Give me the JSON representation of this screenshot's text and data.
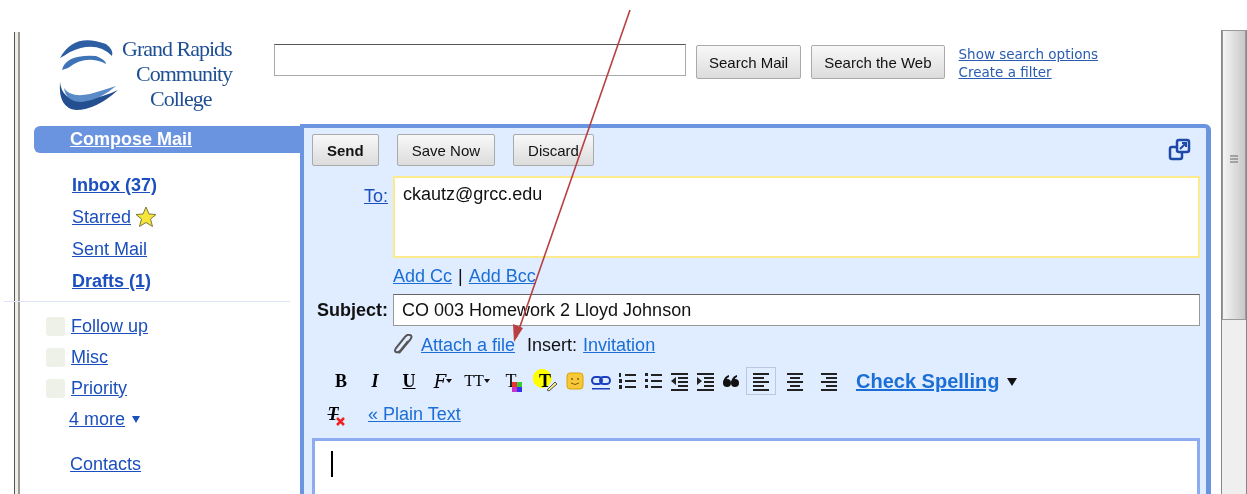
{
  "logo": {
    "lines": [
      "Grand Rapids",
      "Community",
      "College"
    ]
  },
  "search": {
    "buttons": [
      "Search Mail",
      "Search the Web"
    ],
    "links": [
      "Show search options",
      "Create a filter"
    ]
  },
  "sidebar": {
    "compose": "Compose Mail",
    "folders": [
      {
        "label": "Inbox (37)",
        "unread": true,
        "starred": false
      },
      {
        "label": "Starred",
        "unread": false,
        "starred": true
      },
      {
        "label": "Sent Mail",
        "unread": false,
        "starred": false
      },
      {
        "label": "Drafts (1)",
        "unread": true,
        "starred": false
      }
    ],
    "labels": [
      "Follow up",
      "Misc",
      "Priority"
    ],
    "more": "4 more",
    "contacts": "Contacts"
  },
  "compose": {
    "buttons": [
      {
        "label": "Send",
        "primary": true
      },
      {
        "label": "Save Now",
        "primary": false
      },
      {
        "label": "Discard",
        "primary": false
      }
    ],
    "to_label": "To:",
    "to_value": "ckautz@grcc.edu",
    "add_cc": "Add Cc",
    "separator": "|",
    "add_bcc": "Add Bcc",
    "subject_label": "Subject:",
    "subject_value": "CO 003 Homework 2 Lloyd Johnson",
    "attach": "Attach a file",
    "insert_label": "Insert:",
    "insert_link": "Invitation",
    "tools": [
      {
        "kind": "bold",
        "text": "B"
      },
      {
        "kind": "italic",
        "text": "I"
      },
      {
        "kind": "underline",
        "text": "U"
      },
      {
        "kind": "font",
        "text": "F"
      },
      {
        "kind": "size",
        "text": "TT"
      },
      {
        "kind": "text-color",
        "text": "T"
      },
      {
        "kind": "highlight",
        "text": "T"
      },
      {
        "kind": "emoji"
      },
      {
        "kind": "link"
      },
      {
        "kind": "numbered-list"
      },
      {
        "kind": "bullet-list"
      },
      {
        "kind": "outdent"
      },
      {
        "kind": "indent"
      },
      {
        "kind": "quote"
      },
      {
        "kind": "align-left",
        "selected": true
      },
      {
        "kind": "align-center",
        "selected": false
      },
      {
        "kind": "align-right",
        "selected": false
      }
    ],
    "check_spelling": "Check Spelling",
    "remove_format": "T",
    "plain_text": "« Plain Text"
  }
}
